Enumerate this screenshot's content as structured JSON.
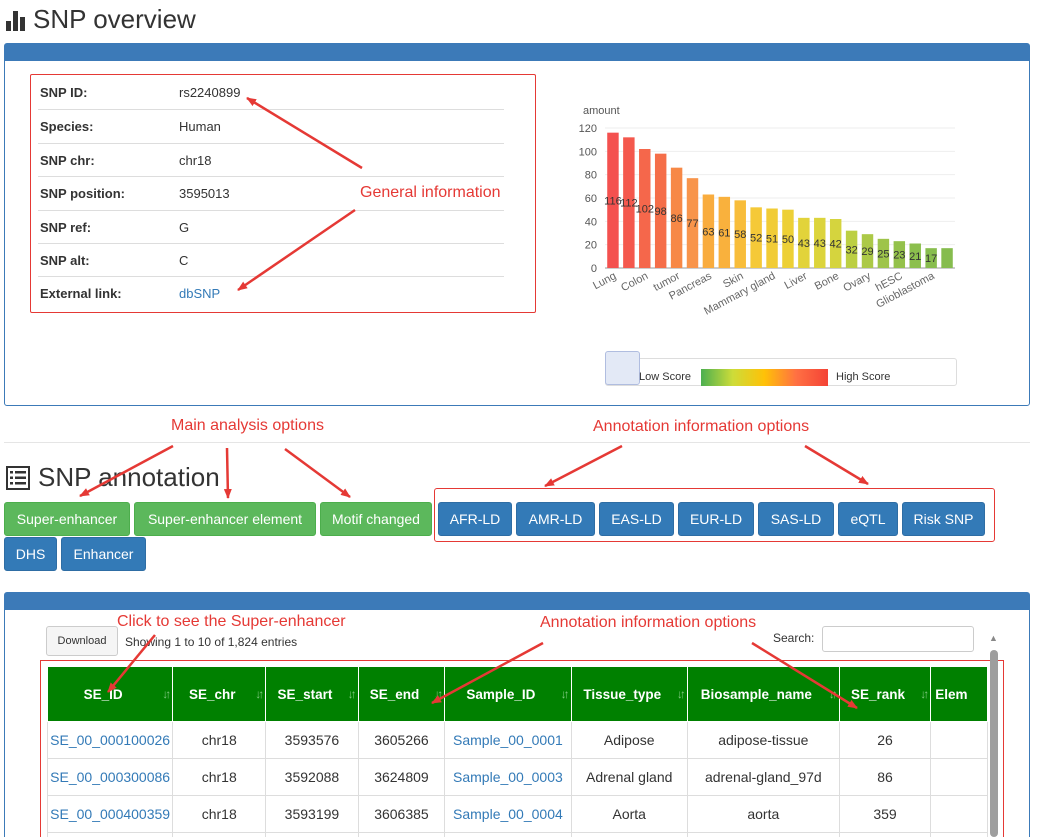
{
  "overview": {
    "title": "SNP overview"
  },
  "info": {
    "rows": [
      {
        "key": "SNP ID:",
        "value": "rs2240899"
      },
      {
        "key": "Species:",
        "value": "Human"
      },
      {
        "key": "SNP chr:",
        "value": "chr18"
      },
      {
        "key": "SNP position:",
        "value": "3595013"
      },
      {
        "key": "SNP ref:",
        "value": "G"
      },
      {
        "key": "SNP alt:",
        "value": "C"
      },
      {
        "key": "External link:",
        "value": "dbSNP"
      }
    ]
  },
  "annotations": {
    "general_information": "General information",
    "main_analysis_options": "Main analysis options",
    "annotation_options_top": "Annotation information options",
    "click_to_see": "Click to see the Super-enhancer",
    "annotation_options_table": "Annotation information options"
  },
  "chart_data": {
    "type": "bar",
    "ylabel": "amount",
    "ylim": [
      0,
      120
    ],
    "yticks": [
      0,
      20,
      40,
      60,
      80,
      100,
      120
    ],
    "categories": [
      "Lung",
      "",
      "Colon",
      "",
      "tumor",
      "",
      "Pancreas",
      "",
      "Skin",
      "",
      "Mammary gland",
      "",
      "Liver",
      "",
      "Bone",
      "",
      "Ovary",
      "",
      "hESC",
      "",
      "Glioblastoma",
      ""
    ],
    "values": [
      116,
      112,
      102,
      98,
      86,
      77,
      63,
      61,
      58,
      52,
      51,
      50,
      43,
      43,
      42,
      32,
      29,
      25,
      23,
      21,
      17,
      17
    ],
    "value_labels": [
      "116",
      "112",
      "102",
      "98",
      "86",
      "77",
      "63",
      "61",
      "58",
      "52",
      "51",
      "50",
      "43",
      "43",
      "42",
      "32",
      "29",
      "25",
      "23",
      "21",
      "17",
      ""
    ],
    "colors": [
      "#f4514f",
      "#f4584d",
      "#f5674b",
      "#f56e49",
      "#f78846",
      "#f8944b",
      "#f9ac3e",
      "#f9b13d",
      "#f8bd3a",
      "#f5c938",
      "#f1cc36",
      "#edd036",
      "#e2d33a",
      "#dcd43c",
      "#d5d43e",
      "#bccf43",
      "#acc947",
      "#9ec44a",
      "#94c14b",
      "#8cbf4d",
      "#88bd4e",
      "#86bc4e"
    ],
    "visual_map": {
      "low_label": "Low Score",
      "high_label": "High Score"
    }
  },
  "snp_annotation": {
    "title": "SNP annotation"
  },
  "main_buttons": [
    "Super-enhancer",
    "Super-enhancer element",
    "Motif changed"
  ],
  "option_buttons": [
    "AFR-LD",
    "AMR-LD",
    "EAS-LD",
    "EUR-LD",
    "SAS-LD",
    "eQTL",
    "Risk SNP",
    "DHS",
    "Enhancer"
  ],
  "table": {
    "download_label": "Download",
    "showing": "Showing 1 to 10 of 1,824 entries",
    "search_label": "Search:",
    "columns": [
      "SE_ID",
      "SE_chr",
      "SE_start",
      "SE_end",
      "Sample_ID",
      "Tissue_type",
      "Biosample_name",
      "SE_rank",
      "Elem"
    ],
    "rows": [
      [
        "SE_00_000100026",
        "chr18",
        "3593576",
        "3605266",
        "Sample_00_0001",
        "Adipose",
        "adipose-tissue",
        "26",
        ""
      ],
      [
        "SE_00_000300086",
        "chr18",
        "3592088",
        "3624809",
        "Sample_00_0003",
        "Adrenal gland",
        "adrenal-gland_97d",
        "86",
        ""
      ],
      [
        "SE_00_000400359",
        "chr18",
        "3593199",
        "3606385",
        "Sample_00_0004",
        "Aorta",
        "aorta",
        "359",
        ""
      ],
      [
        "",
        "",
        "",
        "",
        "",
        "",
        "",
        "",
        ""
      ]
    ]
  }
}
